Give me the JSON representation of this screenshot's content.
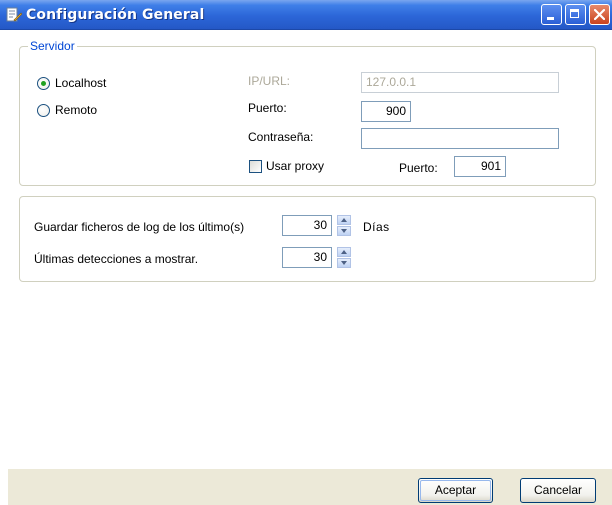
{
  "window": {
    "title": "Configuración General",
    "icon": "settings-app-icon"
  },
  "server": {
    "legend": "Servidor",
    "localhost_label": "Localhost",
    "remote_label": "Remoto",
    "selected": "Localhost",
    "ip_label": "IP/URL:",
    "ip_value": "127.0.0.1",
    "port_label": "Puerto:",
    "port_value": "900",
    "password_label": "Contraseña:",
    "password_value": "",
    "use_proxy_label": "Usar proxy",
    "use_proxy_checked": false,
    "proxy_port_label": "Puerto:",
    "proxy_port_value": "901"
  },
  "logs": {
    "keep_logs_label": "Guardar ficheros de log de los último(s)",
    "keep_logs_value": "30",
    "keep_logs_unit": "Días",
    "last_detections_label": "Últimas detecciones a mostrar.",
    "last_detections_value": "30"
  },
  "buttons": {
    "ok_label": "Aceptar",
    "cancel_label": "Cancelar"
  },
  "colors": {
    "titlebar": "#2c66d8",
    "legend_text": "#0046d5",
    "radio_checked": "#21a121",
    "disabled_text": "#aca899",
    "button_bar": "#ece9d8"
  }
}
